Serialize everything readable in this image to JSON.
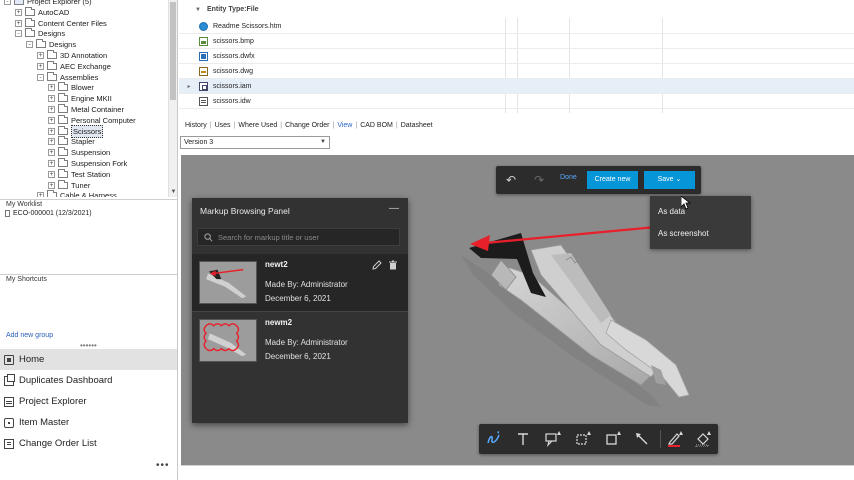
{
  "tree": {
    "items": [
      {
        "label": "Project Explorer (5)",
        "indent": 0,
        "expander": "-",
        "folder": false,
        "selected": false
      },
      {
        "label": "AutoCAD",
        "indent": 1,
        "expander": "+",
        "folder": true,
        "selected": false
      },
      {
        "label": "Content Center Files",
        "indent": 1,
        "expander": "+",
        "folder": true,
        "selected": false
      },
      {
        "label": "Designs",
        "indent": 1,
        "expander": "-",
        "folder": true,
        "selected": false
      },
      {
        "label": "Designs",
        "indent": 2,
        "expander": "-",
        "folder": true,
        "selected": false
      },
      {
        "label": "3D Annotation",
        "indent": 3,
        "expander": "+",
        "folder": true,
        "selected": false
      },
      {
        "label": "AEC Exchange",
        "indent": 3,
        "expander": "+",
        "folder": true,
        "selected": false
      },
      {
        "label": "Assemblies",
        "indent": 3,
        "expander": "-",
        "folder": true,
        "selected": false
      },
      {
        "label": "Blower",
        "indent": 4,
        "expander": "+",
        "folder": true,
        "selected": false
      },
      {
        "label": "Engine MKII",
        "indent": 4,
        "expander": "+",
        "folder": true,
        "selected": false
      },
      {
        "label": "Metal Container",
        "indent": 4,
        "expander": "+",
        "folder": true,
        "selected": false
      },
      {
        "label": "Personal Computer",
        "indent": 4,
        "expander": "+",
        "folder": true,
        "selected": false
      },
      {
        "label": "Scissors",
        "indent": 4,
        "expander": "+",
        "folder": true,
        "selected": true
      },
      {
        "label": "Stapler",
        "indent": 4,
        "expander": "+",
        "folder": true,
        "selected": false
      },
      {
        "label": "Suspension",
        "indent": 4,
        "expander": "+",
        "folder": true,
        "selected": false
      },
      {
        "label": "Suspension Fork",
        "indent": 4,
        "expander": "+",
        "folder": true,
        "selected": false
      },
      {
        "label": "Test Station",
        "indent": 4,
        "expander": "+",
        "folder": true,
        "selected": false
      },
      {
        "label": "Tuner",
        "indent": 4,
        "expander": "+",
        "folder": true,
        "selected": false
      },
      {
        "label": "Cable & Harness",
        "indent": 3,
        "expander": "+",
        "folder": true,
        "selected": false
      }
    ]
  },
  "worklist": {
    "title": "My Worklist",
    "items": [
      "ECO-000001 (12/3/2021)"
    ]
  },
  "shortcuts": {
    "title": "My Shortcuts",
    "add_group": "Add new group"
  },
  "nav": {
    "items": [
      {
        "label": "Home",
        "icon": "home-icon",
        "active": true
      },
      {
        "label": "Duplicates Dashboard",
        "icon": "duplicates-icon",
        "active": false
      },
      {
        "label": "Project Explorer",
        "icon": "project-explorer-icon",
        "active": false
      },
      {
        "label": "Item Master",
        "icon": "item-master-icon",
        "active": false
      },
      {
        "label": "Change Order List",
        "icon": "change-order-icon",
        "active": false
      }
    ],
    "more": "•••"
  },
  "grid": {
    "group_label": "Entity Type:File",
    "rows": [
      {
        "name": "Readme Scissors.htm",
        "icon": "web-file-icon",
        "highlight": false,
        "indicator": ""
      },
      {
        "name": "scissors.bmp",
        "icon": "bmp-file-icon",
        "highlight": false,
        "indicator": ""
      },
      {
        "name": "scissors.dwfx",
        "icon": "dwfx-file-icon",
        "highlight": false,
        "indicator": ""
      },
      {
        "name": "scissors.dwg",
        "icon": "dwg-file-icon",
        "highlight": false,
        "indicator": ""
      },
      {
        "name": "scissors.iam",
        "icon": "iam-file-icon",
        "highlight": true,
        "indicator": "▸"
      },
      {
        "name": "scissors.idw",
        "icon": "idw-file-icon",
        "highlight": false,
        "indicator": ""
      }
    ]
  },
  "tabs": {
    "items": [
      "History",
      "Uses",
      "Where Used",
      "Change Order",
      "View",
      "CAD BOM",
      "Datasheet"
    ],
    "active": "View"
  },
  "version": {
    "selected": "Version 3"
  },
  "toolbar": {
    "done_label": "Done",
    "create_new_label": "Create new",
    "save_label": "Save",
    "save_chevron": "⌄"
  },
  "save_menu": {
    "items": [
      "As data",
      "As screenshot"
    ]
  },
  "markup_panel": {
    "title": "Markup Browsing Panel",
    "minimize": "—",
    "search_placeholder": "Search for markup title or user",
    "markups": [
      {
        "name": "newt2",
        "made_by": "Made By: Administrator",
        "date": "December 6, 2021",
        "selected": true
      },
      {
        "name": "newm2",
        "made_by": "Made By: Administrator",
        "date": "December 6, 2021",
        "selected": false
      }
    ]
  },
  "bottom_tools": [
    {
      "name": "freehand-tool-icon",
      "active": true
    },
    {
      "name": "text-tool-icon",
      "active": false
    },
    {
      "name": "callout-tool-icon",
      "active": false
    },
    {
      "name": "cloud-tool-icon",
      "active": false
    },
    {
      "name": "rectangle-tool-icon",
      "active": false
    },
    {
      "name": "arrow-tool-icon",
      "active": false
    },
    {
      "name": "stroke-color-tool-icon",
      "active": false
    },
    {
      "name": "fill-color-tool-icon",
      "active": false
    }
  ],
  "colors": {
    "accent": "#0696d7",
    "markup_red": "#e8202a",
    "panel_bg": "#323232",
    "viewer_bg": "#8a8a8a",
    "link": "#2a66c4"
  }
}
